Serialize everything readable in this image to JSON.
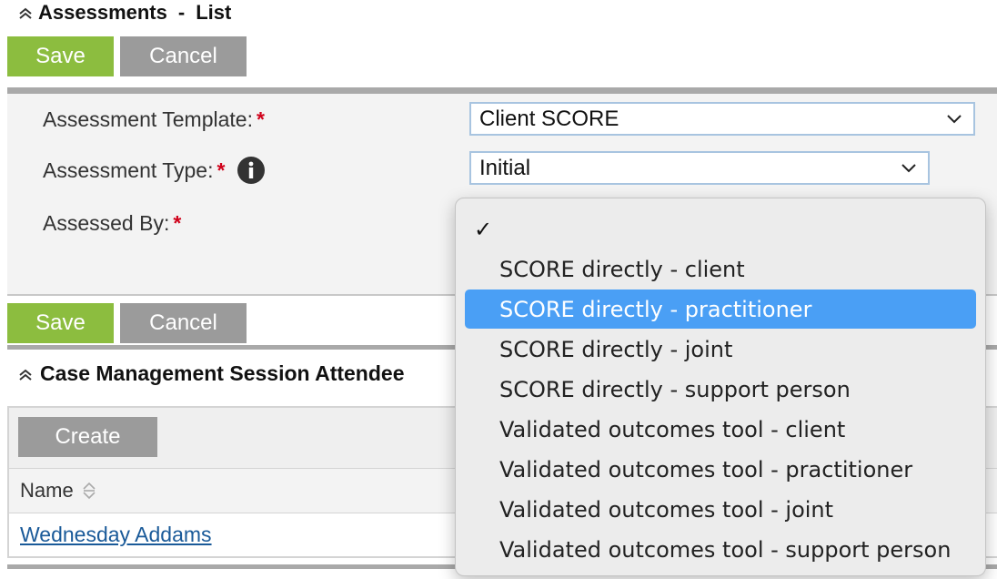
{
  "header": {
    "title": "Assessments",
    "separator": "-",
    "subtitle": "List"
  },
  "toolbar_top": {
    "save_label": "Save",
    "cancel_label": "Cancel"
  },
  "form": {
    "template": {
      "label": "Assessment Template:",
      "required": "*",
      "value": "Client SCORE"
    },
    "type": {
      "label": "Assessment Type:",
      "required": "*",
      "value": "Initial"
    },
    "assessed_by": {
      "label": "Assessed By:",
      "required": "*"
    }
  },
  "toolbar_bottom": {
    "save_label": "Save",
    "cancel_label": "Cancel"
  },
  "attendees": {
    "title": "Case Management Session Attendee",
    "create_label": "Create",
    "columns": [
      "Name"
    ],
    "rows": [
      {
        "name": "Wednesday Addams"
      }
    ]
  },
  "dropdown": {
    "checkmark": "✓",
    "highlighted_index": 1,
    "options": [
      "SCORE directly - client",
      "SCORE directly - practitioner",
      "SCORE directly - joint",
      "SCORE directly - support person",
      "Validated outcomes tool - client",
      "Validated outcomes tool - practitioner",
      "Validated outcomes tool - joint",
      "Validated outcomes tool - support person"
    ]
  },
  "colors": {
    "save": "#8cbd3f",
    "cancel": "#9b9b9b",
    "required": "#d0021b",
    "link": "#1a5a99",
    "highlight": "#4a9ff5"
  }
}
